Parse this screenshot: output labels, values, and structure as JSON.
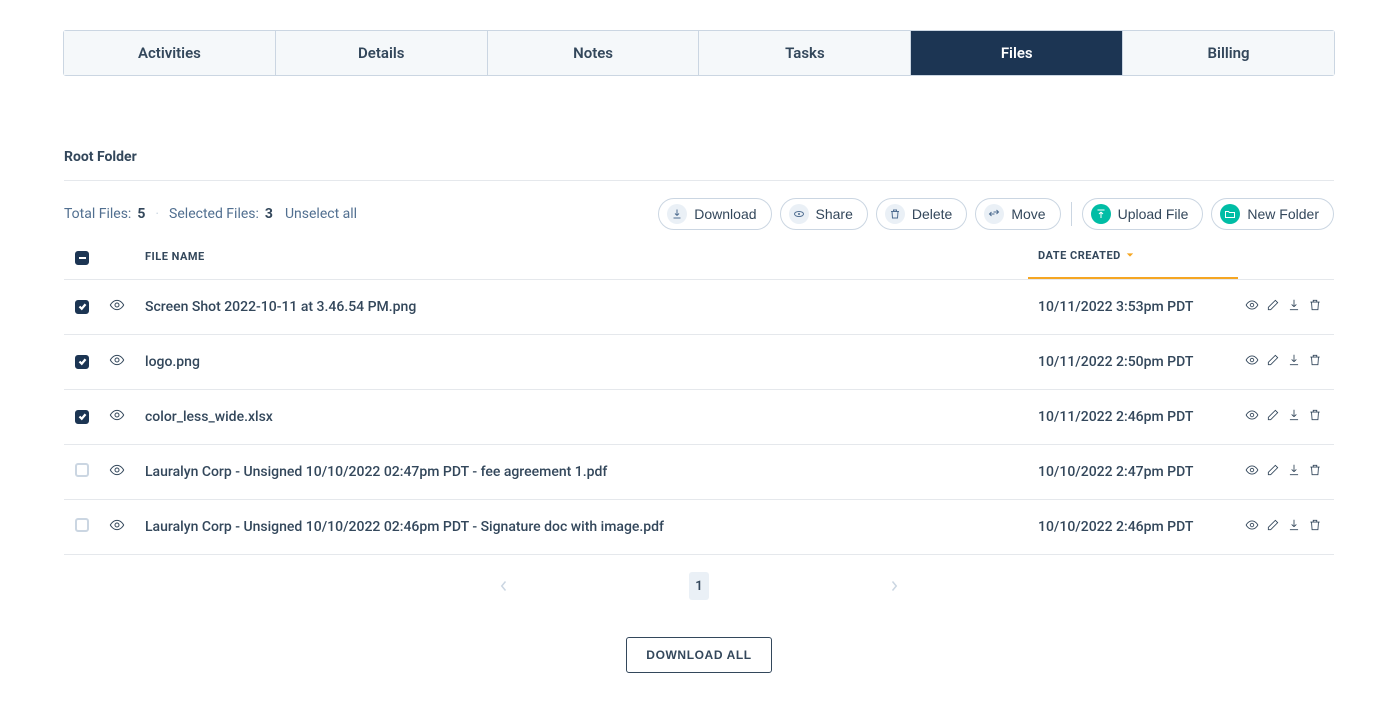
{
  "tabs": {
    "activities": "Activities",
    "details": "Details",
    "notes": "Notes",
    "tasks": "Tasks",
    "files": "Files",
    "billing": "Billing"
  },
  "folder": {
    "title": "Root Folder"
  },
  "stats": {
    "total_label": "Total Files:",
    "total_value": "5",
    "selected_label": "Selected Files:",
    "selected_value": "3",
    "unselect_label": "Unselect all"
  },
  "buttons": {
    "download": "Download",
    "share": "Share",
    "delete": "Delete",
    "move": "Move",
    "upload_file": "Upload File",
    "new_folder": "New Folder",
    "download_all": "DOWNLOAD ALL"
  },
  "columns": {
    "file_name": "FILE NAME",
    "date_created": "DATE CREATED"
  },
  "files": [
    {
      "checked": true,
      "name": "Screen Shot 2022-10-11 at 3.46.54 PM.png",
      "date": "10/11/2022 3:53pm PDT"
    },
    {
      "checked": true,
      "name": "logo.png",
      "date": "10/11/2022 2:50pm PDT"
    },
    {
      "checked": true,
      "name": "color_less_wide.xlsx",
      "date": "10/11/2022 2:46pm PDT"
    },
    {
      "checked": false,
      "name": "Lauralyn Corp - Unsigned 10/10/2022 02:47pm PDT - fee agreement 1.pdf",
      "date": "10/10/2022 2:47pm PDT"
    },
    {
      "checked": false,
      "name": "Lauralyn Corp - Unsigned 10/10/2022 02:46pm PDT - Signature doc with image.pdf",
      "date": "10/10/2022 2:46pm PDT"
    }
  ],
  "pagination": {
    "current": "1"
  }
}
